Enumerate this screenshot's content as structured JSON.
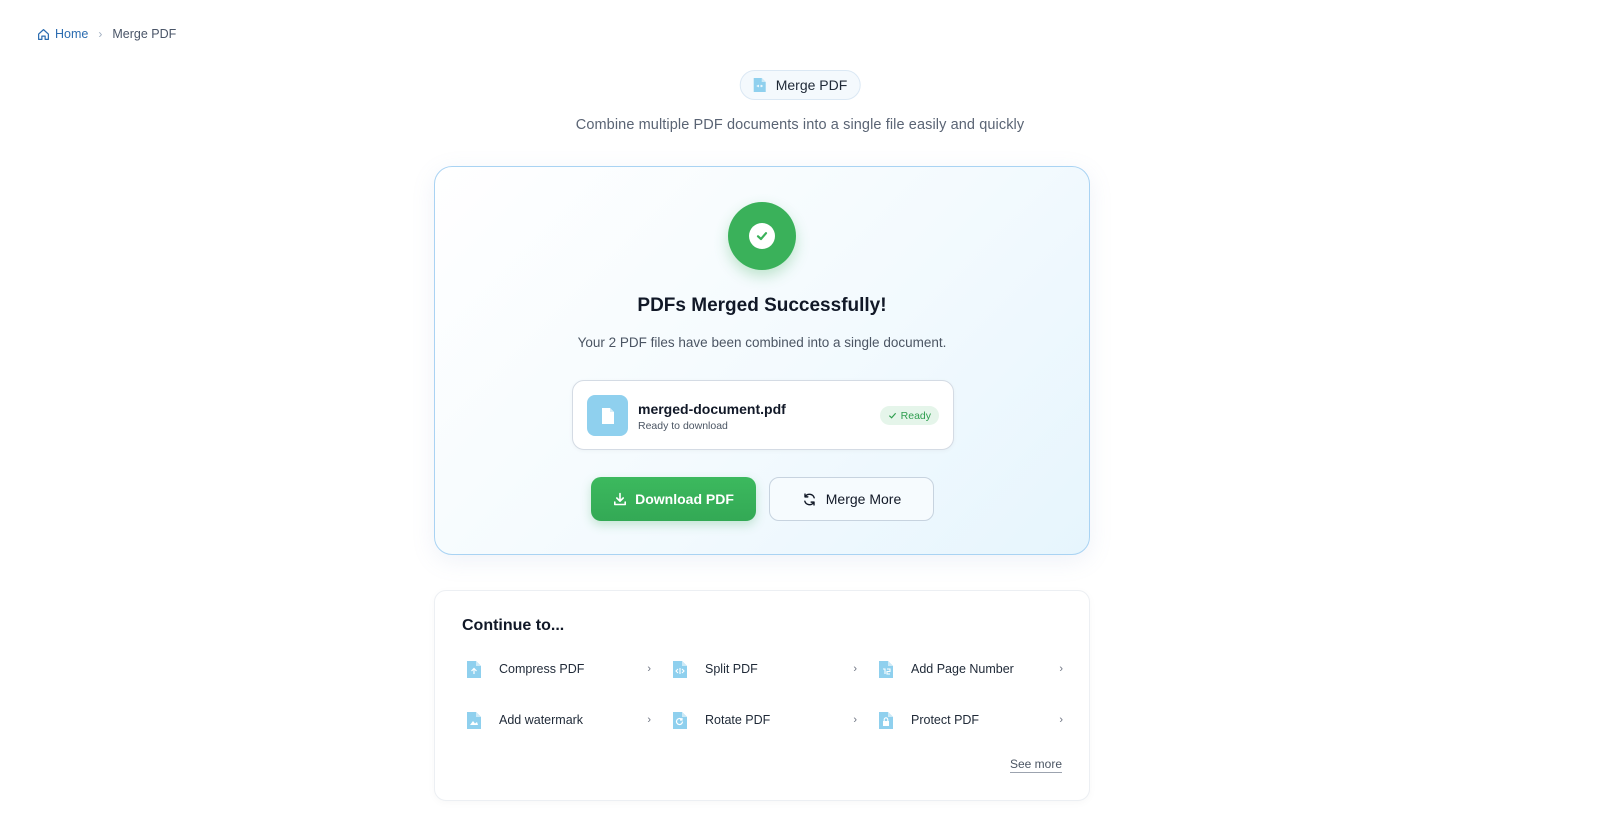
{
  "breadcrumb": {
    "home": "Home",
    "separator": "›",
    "current": "Merge PDF"
  },
  "badge": {
    "label": "Merge PDF"
  },
  "subtitle": "Combine multiple PDF documents into a single file easily and quickly",
  "result": {
    "title": "PDFs Merged Successfully!",
    "description": "Your 2 PDF files have been combined into a single document.",
    "file": {
      "name": "merged-document.pdf",
      "status": "Ready to download",
      "badge": "Ready"
    },
    "download_label": "Download PDF",
    "merge_more_label": "Merge More"
  },
  "continue": {
    "title": "Continue to...",
    "tools": [
      {
        "label": "Compress PDF",
        "icon": "compress-icon"
      },
      {
        "label": "Split PDF",
        "icon": "split-icon"
      },
      {
        "label": "Add Page Number",
        "icon": "page-number-icon"
      },
      {
        "label": "Add watermark",
        "icon": "watermark-icon"
      },
      {
        "label": "Rotate PDF",
        "icon": "rotate-icon"
      },
      {
        "label": "Protect PDF",
        "icon": "lock-icon"
      }
    ],
    "chevron": "›",
    "see_more": "See more"
  },
  "colors": {
    "accent_green": "#3ab15a",
    "accent_blue": "#8fd0ee",
    "link_blue": "#2b6cb0"
  }
}
